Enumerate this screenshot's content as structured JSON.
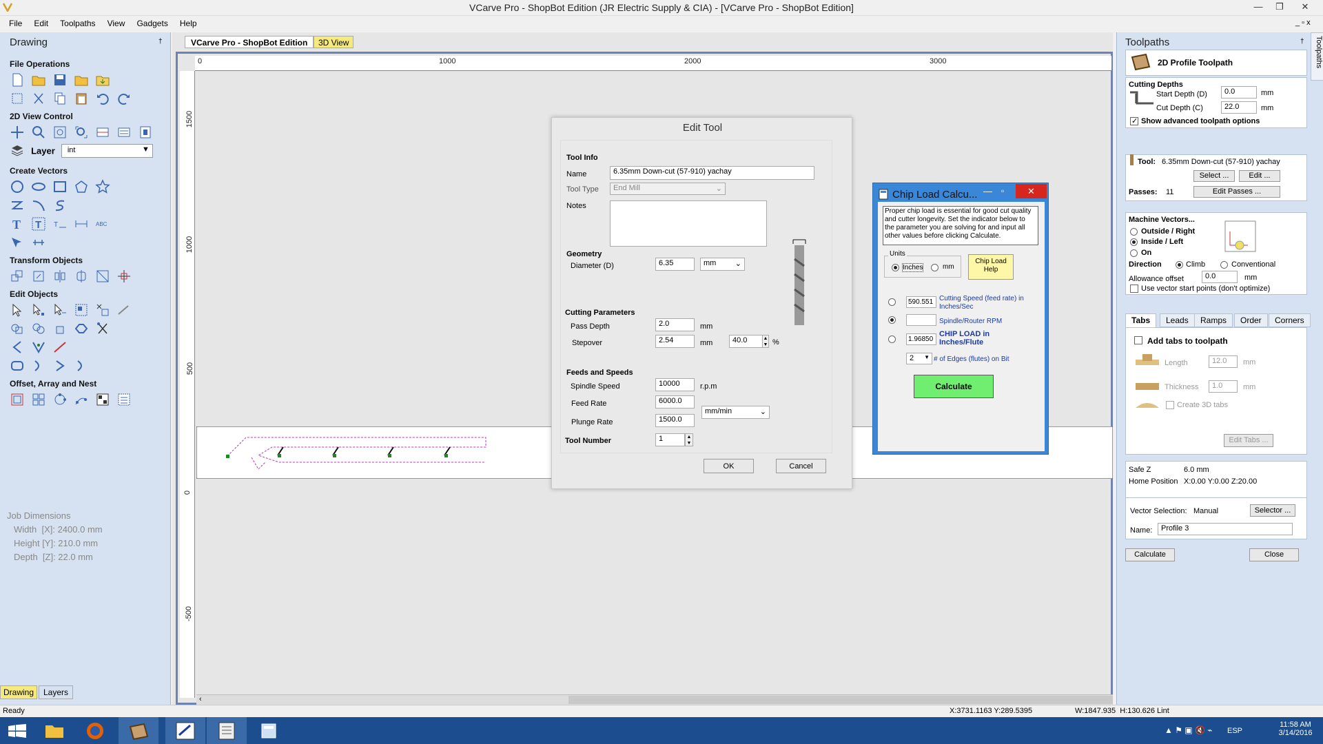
{
  "window": {
    "title": "VCarve Pro - ShopBot Edition (JR Electric Supply & CIA) - [VCarve Pro - ShopBot Edition]",
    "min_glyph": "—",
    "restore_glyph": "❐",
    "close_glyph": "✕"
  },
  "menu": [
    "File",
    "Edit",
    "Toolpaths",
    "View",
    "Gadgets",
    "Help"
  ],
  "left_panel": {
    "title": "Drawing",
    "pin": "†",
    "sections": {
      "file_ops": "File Operations",
      "view_ctrl": "2D View Control",
      "layer_label": "Layer",
      "layer_value": "int",
      "create_vectors": "Create Vectors",
      "transform": "Transform Objects",
      "edit_objects": "Edit Objects",
      "offset": "Offset, Array and Nest"
    },
    "job": {
      "title": "Job Dimensions",
      "width": "Width  [X]: 2400.0 mm",
      "height": "Height [Y]: 210.0 mm",
      "depth": "Depth  [Z]: 22.0 mm"
    },
    "tabs": [
      "Drawing",
      "Layers"
    ]
  },
  "doc_tabs": [
    "VCarve Pro - ShopBot Edition",
    "3D View"
  ],
  "ruler": {
    "h": [
      "0",
      "1000",
      "2000",
      "3000"
    ],
    "v": [
      "1500",
      "1000",
      "500",
      "0",
      "-500"
    ]
  },
  "edit_tool": {
    "title": "Edit Tool",
    "tool_info": "Tool Info",
    "name_label": "Name",
    "name_value": "6.35mm Down-cut (57-910) yachay",
    "tool_type_label": "Tool Type",
    "tool_type_value": "End Mill",
    "notes_label": "Notes",
    "geometry": "Geometry",
    "diameter_label": "Diameter (D)",
    "diameter_value": "6.35",
    "diameter_unit": "mm",
    "cutting_params": "Cutting Parameters",
    "pass_depth_label": "Pass Depth",
    "pass_depth_value": "2.0",
    "pass_depth_unit": "mm",
    "stepover_label": "Stepover",
    "stepover_value": "2.54",
    "stepover_unit": "mm",
    "stepover_pct": "40.0",
    "pct": "%",
    "feeds": "Feeds and Speeds",
    "spindle_label": "Spindle Speed",
    "spindle_value": "10000",
    "spindle_unit": "r.p.m",
    "feed_label": "Feed Rate",
    "feed_value": "6000.0",
    "plunge_label": "Plunge Rate",
    "plunge_value": "1500.0",
    "rate_unit": "mm/min",
    "tool_number_label": "Tool Number",
    "tool_number_value": "1",
    "ok": "OK",
    "cancel": "Cancel"
  },
  "chip_load": {
    "title": "Chip Load Calcu...",
    "description": "Proper chip load is essential for good cut quality and cutter longevity. Set the indicator below to the parameter you are solving for and input all other values before clicking Calculate.",
    "units_label": "Units",
    "inches": "Inches",
    "mm": "mm",
    "help": "Chip Load Help",
    "cutting_speed_value": "590.551",
    "cutting_speed_label": "Cutting Speed (feed rate) in Inches/Sec",
    "rpm_value": "",
    "rpm_label": "Spindle/Router RPM",
    "chipload_value": "1.96850",
    "chipload_label": "CHIP LOAD in Inches/Flute",
    "edges_value": "2",
    "edges_label": "# of Edges (flutes) on Bit",
    "calculate": "Calculate",
    "accent": "#6fee6f"
  },
  "right_panel": {
    "title": "Toolpaths",
    "side_tab": "Toolpaths",
    "header": "2D Profile Toolpath",
    "cutting_depths": "Cutting Depths",
    "start_depth_label": "Start Depth (D)",
    "start_depth_value": "0.0",
    "cut_depth_label": "Cut Depth (C)",
    "cut_depth_value": "22.0",
    "unit": "mm",
    "advanced": "Show advanced toolpath options",
    "tool_label": "Tool:",
    "tool_value": "6.35mm Down-cut (57-910) yachay",
    "select": "Select ...",
    "edit": "Edit ...",
    "passes_label": "Passes:",
    "passes_value": "11",
    "edit_passes": "Edit Passes ...",
    "machine_vectors": "Machine Vectors...",
    "outside": "Outside / Right",
    "inside": "Inside / Left",
    "on": "On",
    "direction": "Direction",
    "climb": "Climb",
    "conventional": "Conventional",
    "allowance_label": "Allowance offset",
    "allowance_value": "0.0",
    "start_points": "Use vector start points (don't optimize)",
    "tabs": [
      "Tabs",
      "Leads",
      "Ramps",
      "Order",
      "Corners"
    ],
    "add_tabs": "Add tabs to toolpath",
    "length_label": "Length",
    "length_value": "12.0",
    "thickness_label": "Thickness",
    "thickness_value": "1.0",
    "create_3d": "Create 3D tabs",
    "edit_tabs": "Edit Tabs ...",
    "safe_z_label": "Safe Z",
    "safe_z_value": "6.0 mm",
    "home_label": "Home Position",
    "home_value": "X:0.00 Y:0.00 Z:20.00",
    "vector_sel_label": "Vector Selection:",
    "vector_sel_value": "Manual",
    "selector": "Selector ...",
    "name_label": "Name:",
    "name_value": "Profile 3",
    "calculate": "Calculate",
    "close": "Close"
  },
  "status": {
    "ready": "Ready",
    "coords": "X:3731.1163 Y:289.5395",
    "wh": "W:1847.935  H:130.626 Lint"
  },
  "taskbar": {
    "lang": "ESP",
    "time": "11:58 AM",
    "date": "3/14/2016",
    "color": "#1c4e8f"
  }
}
